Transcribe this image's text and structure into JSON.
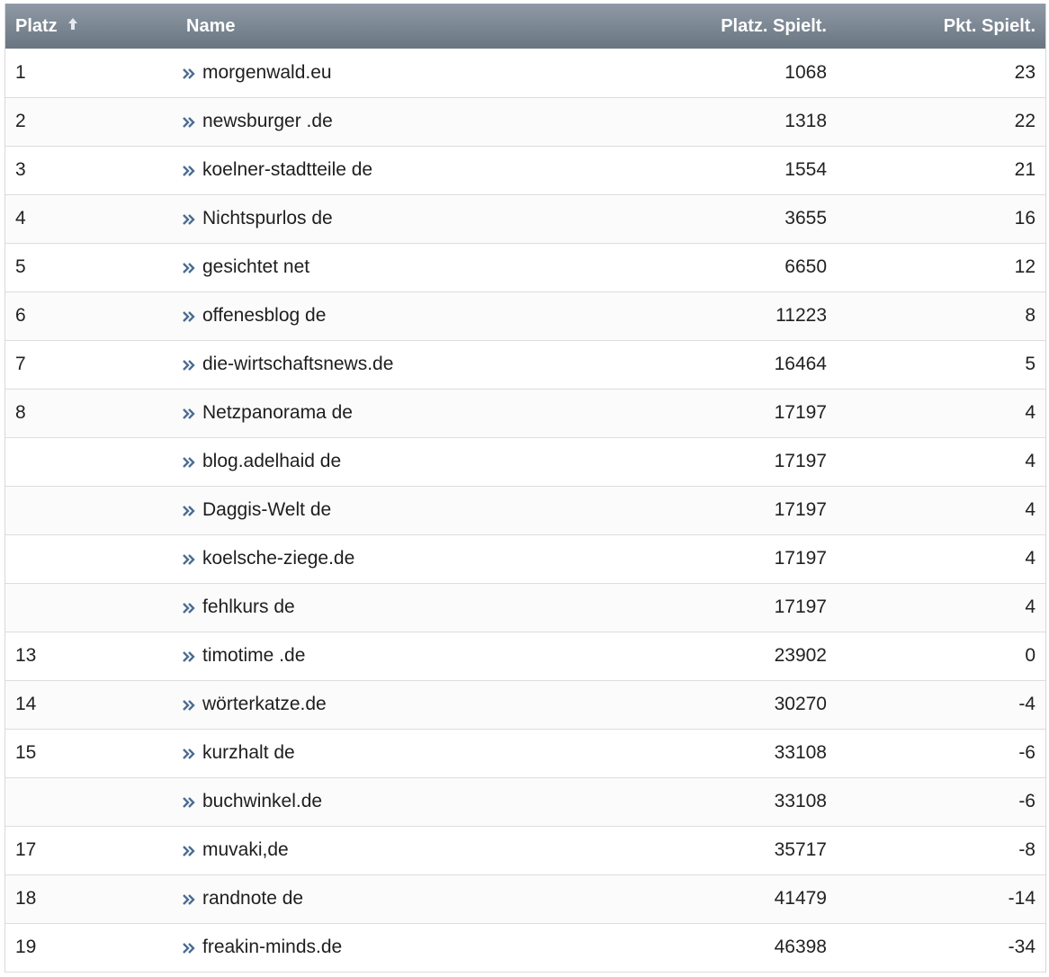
{
  "table": {
    "columns": [
      {
        "label": "Platz",
        "sorted": "ascending"
      },
      {
        "label": "Name"
      },
      {
        "label": "Platz. Spielt."
      },
      {
        "label": "Pkt. Spielt."
      }
    ],
    "rows": [
      {
        "platz": "1",
        "name": "morgenwald.eu",
        "platz_spielt": "1068",
        "pkt_spielt": "23"
      },
      {
        "platz": "2",
        "name": "newsburger .de",
        "platz_spielt": "1318",
        "pkt_spielt": "22"
      },
      {
        "platz": "3",
        "name": "koelner-stadtteile de",
        "platz_spielt": "1554",
        "pkt_spielt": "21"
      },
      {
        "platz": "4",
        "name": "Nichtspurlos de",
        "platz_spielt": "3655",
        "pkt_spielt": "16"
      },
      {
        "platz": "5",
        "name": "gesichtet net",
        "platz_spielt": "6650",
        "pkt_spielt": "12"
      },
      {
        "platz": "6",
        "name": "offenesblog de",
        "platz_spielt": "11223",
        "pkt_spielt": "8"
      },
      {
        "platz": "7",
        "name": "die-wirtschaftsnews.de",
        "platz_spielt": "16464",
        "pkt_spielt": "5"
      },
      {
        "platz": "8",
        "name": "Netzpanorama de",
        "platz_spielt": "17197",
        "pkt_spielt": "4"
      },
      {
        "platz": "",
        "name": "blog.adelhaid de",
        "platz_spielt": "17197",
        "pkt_spielt": "4"
      },
      {
        "platz": "",
        "name": "Daggis-Welt de",
        "platz_spielt": "17197",
        "pkt_spielt": "4"
      },
      {
        "platz": "",
        "name": "koelsche-ziege.de",
        "platz_spielt": "17197",
        "pkt_spielt": "4"
      },
      {
        "platz": "",
        "name": "fehlkurs de",
        "platz_spielt": "17197",
        "pkt_spielt": "4"
      },
      {
        "platz": "13",
        "name": "timotime .de",
        "platz_spielt": "23902",
        "pkt_spielt": "0"
      },
      {
        "platz": "14",
        "name": "wörterkatze.de",
        "platz_spielt": "30270",
        "pkt_spielt": "-4"
      },
      {
        "platz": "15",
        "name": "kurzhalt de",
        "platz_spielt": "33108",
        "pkt_spielt": "-6"
      },
      {
        "platz": "",
        "name": "buchwinkel.de",
        "platz_spielt": "33108",
        "pkt_spielt": "-6"
      },
      {
        "platz": "17",
        "name": "muvaki,de",
        "platz_spielt": "35717",
        "pkt_spielt": "-8"
      },
      {
        "platz": "18",
        "name": "randnote de",
        "platz_spielt": "41479",
        "pkt_spielt": "-14"
      },
      {
        "platz": "19",
        "name": "freakin-minds.de",
        "platz_spielt": "46398",
        "pkt_spielt": "-34"
      }
    ]
  },
  "icons": {
    "sort": "sort-ascending-icon",
    "row_link": "double-chevron-right-icon"
  },
  "colors": {
    "header_top": "#8f9aa6",
    "header_bottom": "#6a7582",
    "header_text": "#ffffff",
    "link_arrow": "#4b6d93",
    "row_border": "#dddddd"
  }
}
